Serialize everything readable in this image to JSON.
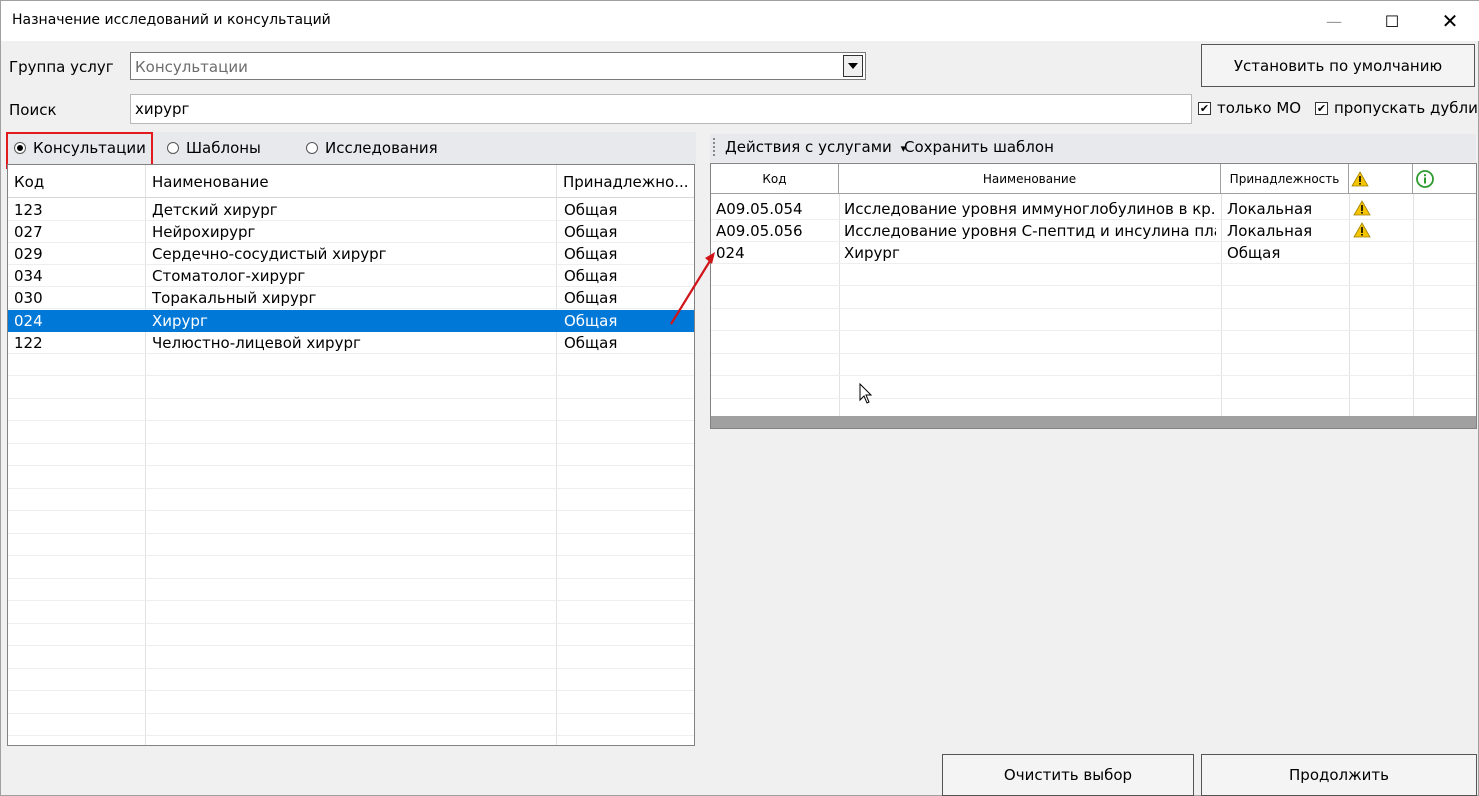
{
  "window": {
    "title": "Назначение исследований и консультаций",
    "minimize_label": "—",
    "maximize_label": "☐",
    "close_label": "✕"
  },
  "group": {
    "label": "Группа услуг",
    "value": "Консультации"
  },
  "default_button": "Установить по умолчанию",
  "search": {
    "label": "Поиск",
    "value": "хирург"
  },
  "options": {
    "only_mo": {
      "label": "только МО",
      "checked": true
    },
    "skip_duplicates": {
      "label": "пропускать дубли",
      "checked": true
    }
  },
  "modes": [
    {
      "label": "Консультации",
      "selected": true
    },
    {
      "label": "Шаблоны",
      "selected": false
    },
    {
      "label": "Исследования",
      "selected": false
    }
  ],
  "left_grid": {
    "columns": [
      "Код",
      "Наименование",
      "Принадлежно..."
    ],
    "rows": [
      {
        "code": "123",
        "name": "Детский хирург",
        "owner": "Общая",
        "selected": false
      },
      {
        "code": "027",
        "name": "Нейрохирург",
        "owner": "Общая",
        "selected": false
      },
      {
        "code": "029",
        "name": "Сердечно-сосудистый хирург",
        "owner": "Общая",
        "selected": false
      },
      {
        "code": "034",
        "name": "Стоматолог-хирург",
        "owner": "Общая",
        "selected": false
      },
      {
        "code": "030",
        "name": "Торакальный хирург",
        "owner": "Общая",
        "selected": false
      },
      {
        "code": "024",
        "name": "Хирург",
        "owner": "Общая",
        "selected": true
      },
      {
        "code": "122",
        "name": "Челюстно-лицевой хирург",
        "owner": "Общая",
        "selected": false
      }
    ]
  },
  "toolbar": {
    "actions_label": "Действия с услугами",
    "actions_caret": "▾",
    "save_template_label": "Сохранить шаблон"
  },
  "right_grid": {
    "columns": [
      "Код",
      "Наименование",
      "Принадлежность"
    ],
    "warning_icon": "warning-icon",
    "info_icon": "info-icon",
    "rows": [
      {
        "code": "A09.05.054",
        "name": "Исследование уровня иммуноглобулинов в кр...",
        "owner": "Локальная",
        "warning": true
      },
      {
        "code": "A09.05.056",
        "name": "Исследование уровня С-пептид и инсулина пла...",
        "owner": "Локальная",
        "warning": true
      },
      {
        "code": "024",
        "name": "Хирург",
        "owner": "Общая",
        "warning": false
      }
    ]
  },
  "buttons": {
    "clear": "Очистить выбор",
    "continue": "Продолжить"
  },
  "colors": {
    "selection": "#0078d7",
    "highlight_frame": "#e11b1b",
    "arrow": "#d0141a",
    "warning": "#f5c400",
    "info": "#2e9b2e"
  }
}
